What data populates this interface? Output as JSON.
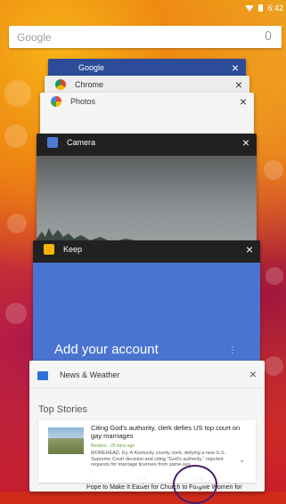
{
  "status_bar": {
    "time": "6:42"
  },
  "search": {
    "placeholder": "Google"
  },
  "cards": {
    "google": {
      "title": "Google"
    },
    "chrome": {
      "title": "Chrome"
    },
    "photos": {
      "title": "Photos"
    },
    "camera": {
      "title": "Camera"
    },
    "keep": {
      "title": "Keep",
      "add_account": "Add your account"
    },
    "news": {
      "title": "News & Weather",
      "section": "Top Stories",
      "story": {
        "headline": "Citing God's authority, clerk defies US top court on gay marriages",
        "source": "Reuters · 25 mins ago",
        "summary": "MOREHEAD, Ky. A Kentucky county clerk, defying a new U.S. Supreme Court decision and citing \"God's authority,\" rejected requests for marriage licenses from same-sex..."
      },
      "next_story": "Pope to Make It Easier for Church to Forgive Women for"
    }
  },
  "nav": {
    "back": "◁",
    "home": "○",
    "recents": "□"
  },
  "colors": {
    "accent": "#4a74d0",
    "status": "#ffffff"
  }
}
